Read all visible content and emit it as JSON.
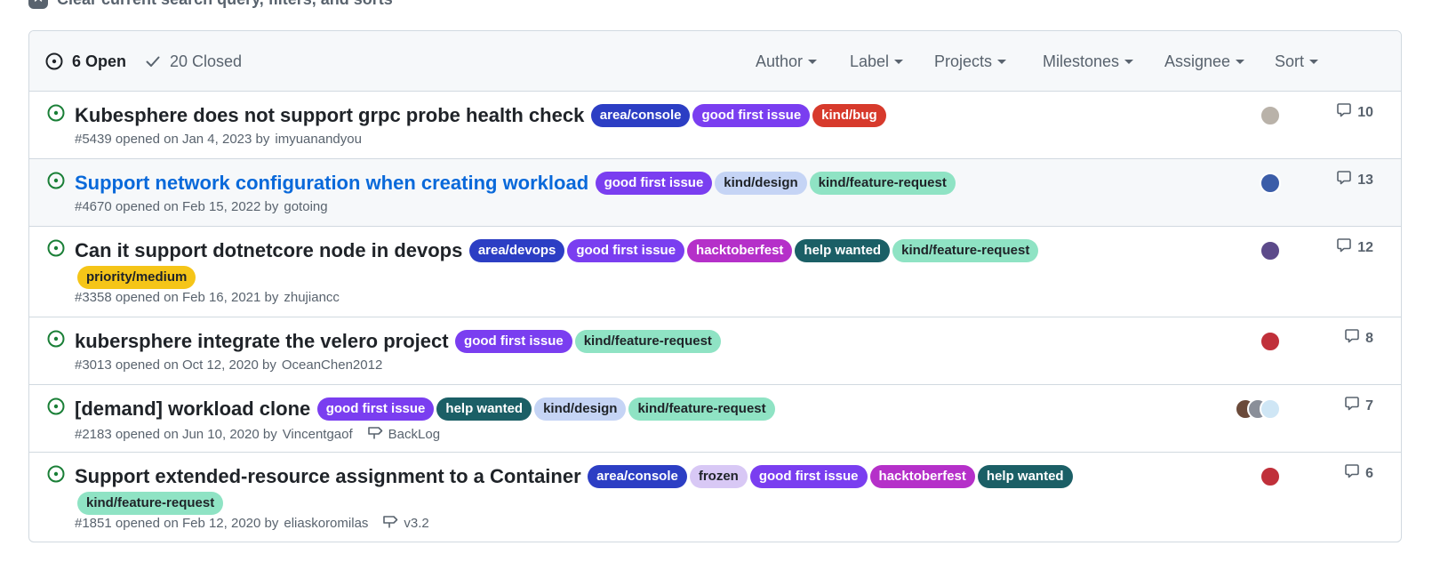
{
  "clear_filters": "Clear current search query, filters, and sorts",
  "header": {
    "open_label": "6 Open",
    "closed_label": "20 Closed",
    "filters": [
      "Author",
      "Label",
      "Projects",
      "Milestones",
      "Assignee",
      "Sort"
    ]
  },
  "issues": [
    {
      "title": "Kubesphere does not support grpc probe health check",
      "labels": [
        {
          "text": "area/console",
          "bg": "#2c3ec4",
          "fg": "#ffffff"
        },
        {
          "text": "good first issue",
          "bg": "#7a3ef0",
          "fg": "#ffffff"
        },
        {
          "text": "kind/bug",
          "bg": "#d73a2c",
          "fg": "#ffffff"
        }
      ],
      "meta": "#5439 opened on Jan 4, 2023 by",
      "author": "imyuanandyou",
      "milestone": "",
      "avatars": [
        "#b9b2a9"
      ],
      "comments": "10"
    },
    {
      "title": "Support network configuration when creating workload",
      "title_link": true,
      "labels": [
        {
          "text": "good first issue",
          "bg": "#7a3ef0",
          "fg": "#ffffff"
        },
        {
          "text": "kind/design",
          "bg": "#c5d4f5",
          "fg": "#1f2328"
        },
        {
          "text": "kind/feature-request",
          "bg": "#8fe3c4",
          "fg": "#1f2328"
        }
      ],
      "meta": "#4670 opened on Feb 15, 2022 by",
      "author": "gotoing",
      "milestone": "",
      "avatars": [
        "#3b5da8"
      ],
      "comments": "13"
    },
    {
      "title": "Can it support dotnetcore node in devops",
      "labels": [
        {
          "text": "area/devops",
          "bg": "#2c3ec4",
          "fg": "#ffffff"
        },
        {
          "text": "good first issue",
          "bg": "#7a3ef0",
          "fg": "#ffffff"
        },
        {
          "text": "hacktoberfest",
          "bg": "#b530c9",
          "fg": "#ffffff"
        },
        {
          "text": "help wanted",
          "bg": "#1b5f66",
          "fg": "#ffffff"
        },
        {
          "text": "kind/feature-request",
          "bg": "#8fe3c4",
          "fg": "#1f2328"
        },
        {
          "text": "priority/medium",
          "bg": "#f5c518",
          "fg": "#1f2328"
        }
      ],
      "meta": "#3358 opened on Feb 16, 2021 by",
      "author": "zhujiancc",
      "milestone": "",
      "avatars": [
        "#5c4a8a"
      ],
      "comments": "12"
    },
    {
      "title": "kubersphere integrate the velero project",
      "labels": [
        {
          "text": "good first issue",
          "bg": "#7a3ef0",
          "fg": "#ffffff"
        },
        {
          "text": "kind/feature-request",
          "bg": "#8fe3c4",
          "fg": "#1f2328"
        }
      ],
      "meta": "#3013 opened on Oct 12, 2020 by",
      "author": "OceanChen2012",
      "milestone": "",
      "avatars": [
        "#c0303a"
      ],
      "comments": "8"
    },
    {
      "title": "[demand] workload clone",
      "labels": [
        {
          "text": "good first issue",
          "bg": "#7a3ef0",
          "fg": "#ffffff"
        },
        {
          "text": "help wanted",
          "bg": "#1b5f66",
          "fg": "#ffffff"
        },
        {
          "text": "kind/design",
          "bg": "#c5d4f5",
          "fg": "#1f2328"
        },
        {
          "text": "kind/feature-request",
          "bg": "#8fe3c4",
          "fg": "#1f2328"
        }
      ],
      "meta": "#2183 opened on Jun 10, 2020 by",
      "author": "Vincentgaof",
      "milestone": "BackLog",
      "avatars": [
        "#6b4a3a",
        "#8a8f99",
        "#cfe6f5"
      ],
      "comments": "7"
    },
    {
      "title": "Support extended-resource assignment to a Container",
      "labels": [
        {
          "text": "area/console",
          "bg": "#2c3ec4",
          "fg": "#ffffff"
        },
        {
          "text": "frozen",
          "bg": "#d8c8f5",
          "fg": "#1f2328"
        },
        {
          "text": "good first issue",
          "bg": "#7a3ef0",
          "fg": "#ffffff"
        },
        {
          "text": "hacktoberfest",
          "bg": "#b530c9",
          "fg": "#ffffff"
        },
        {
          "text": "help wanted",
          "bg": "#1b5f66",
          "fg": "#ffffff"
        },
        {
          "text": "kind/feature-request",
          "bg": "#8fe3c4",
          "fg": "#1f2328"
        }
      ],
      "meta": "#1851 opened on Feb 12, 2020 by",
      "author": "eliaskoromilas",
      "milestone": "v3.2",
      "avatars": [
        "#c0303a"
      ],
      "comments": "6"
    }
  ]
}
